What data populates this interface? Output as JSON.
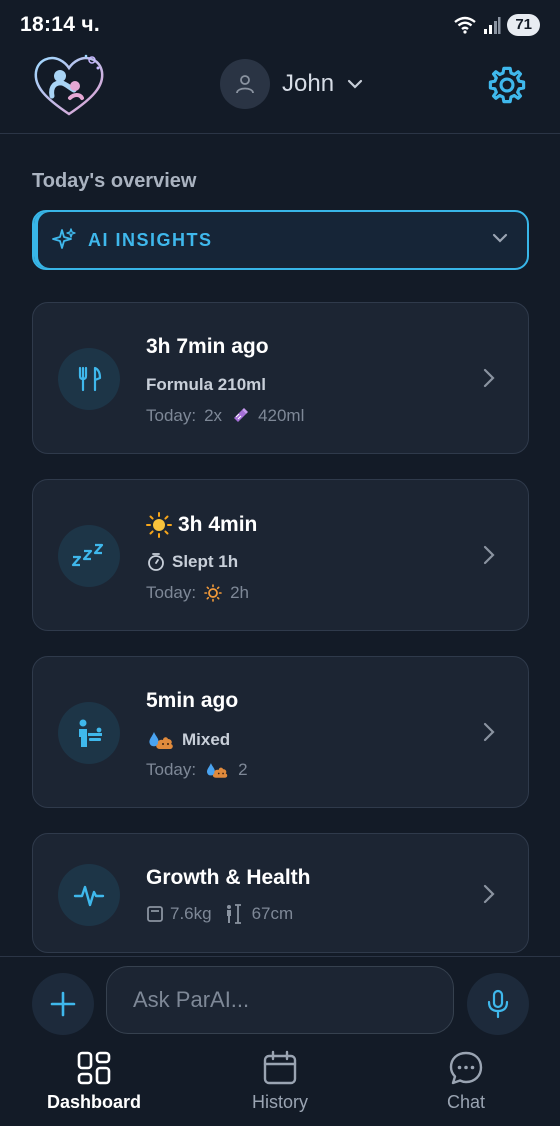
{
  "status_bar": {
    "time": "18:14 ч.",
    "battery": "71"
  },
  "header": {
    "user_name": "John"
  },
  "overview": {
    "title": "Today's overview"
  },
  "ai_insights": {
    "label": "AI INSIGHTS"
  },
  "cards": {
    "feeding": {
      "title": "3h 7min ago",
      "subtitle": "Formula 210ml",
      "today_label": "Today:",
      "count": "2x",
      "total": "420ml"
    },
    "sleep": {
      "title": "3h 4min",
      "subtitle": "Slept 1h",
      "today_label": "Today:",
      "total": "2h"
    },
    "diaper": {
      "title": "5min ago",
      "subtitle": "Mixed",
      "today_label": "Today:",
      "count": "2"
    },
    "growth": {
      "title": "Growth & Health",
      "weight": "7.6kg",
      "height": "67cm"
    }
  },
  "input": {
    "placeholder": "Ask ParAI..."
  },
  "tabs": [
    {
      "label": "Dashboard",
      "icon": "dashboard-icon",
      "active": true
    },
    {
      "label": "History",
      "icon": "calendar-icon",
      "active": false
    },
    {
      "label": "Chat",
      "icon": "chat-icon",
      "active": false
    }
  ],
  "colors": {
    "accent": "#38b6e8",
    "background": "#131b27",
    "card": "#1c2533"
  }
}
